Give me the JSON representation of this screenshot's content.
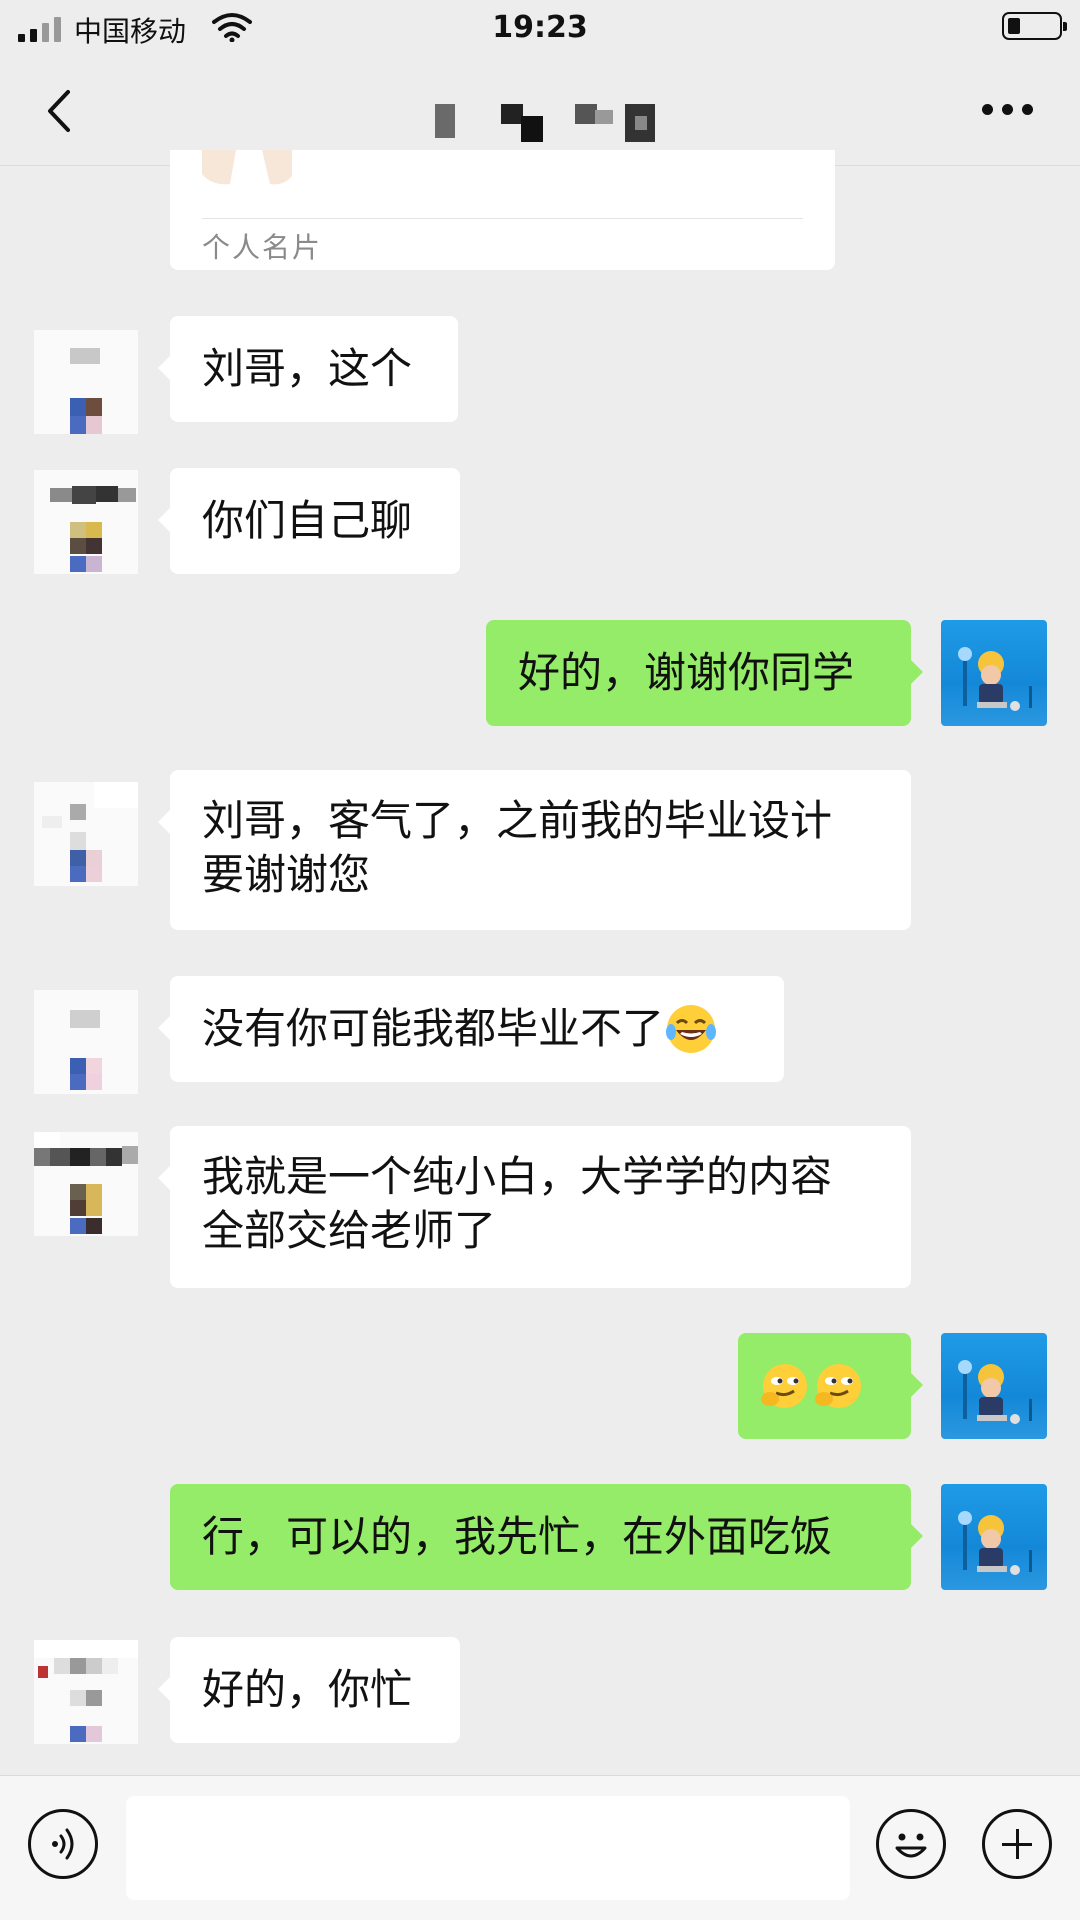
{
  "status_bar": {
    "carrier": "中国移动",
    "time": "19:23"
  },
  "nav": {
    "back_icon": "chevron-left-icon",
    "more_icon": "more-dots-icon"
  },
  "card": {
    "label": "个人名片"
  },
  "messages": [
    {
      "side": "left",
      "text": "刘哥，这个"
    },
    {
      "side": "left",
      "text": "你们自己聊"
    },
    {
      "side": "right",
      "text": "好的，谢谢你同学"
    },
    {
      "side": "left",
      "text_line1": "刘哥，客气了，之前我的毕业设计",
      "text_line2": "要谢谢您"
    },
    {
      "side": "left",
      "text": "没有你可能我都毕业不了",
      "emoji": "tears-of-joy-emoji"
    },
    {
      "side": "left",
      "text_line1": "我就是一个纯小白，大学学的内容",
      "text_line2": "全部交给老师了"
    },
    {
      "side": "right",
      "emoji": "smirk-emoji-pair"
    },
    {
      "side": "right",
      "text": "行，可以的，我先忙，在外面吃饭"
    },
    {
      "side": "left",
      "text": "好的，你忙"
    }
  ],
  "input_bar": {
    "voice_icon": "voice-icon",
    "emoji_icon": "emoji-icon",
    "plus_icon": "plus-icon",
    "input_value": ""
  },
  "colors": {
    "background": "#ededed",
    "sent_bubble": "#95ec69",
    "received_bubble": "#ffffff"
  }
}
